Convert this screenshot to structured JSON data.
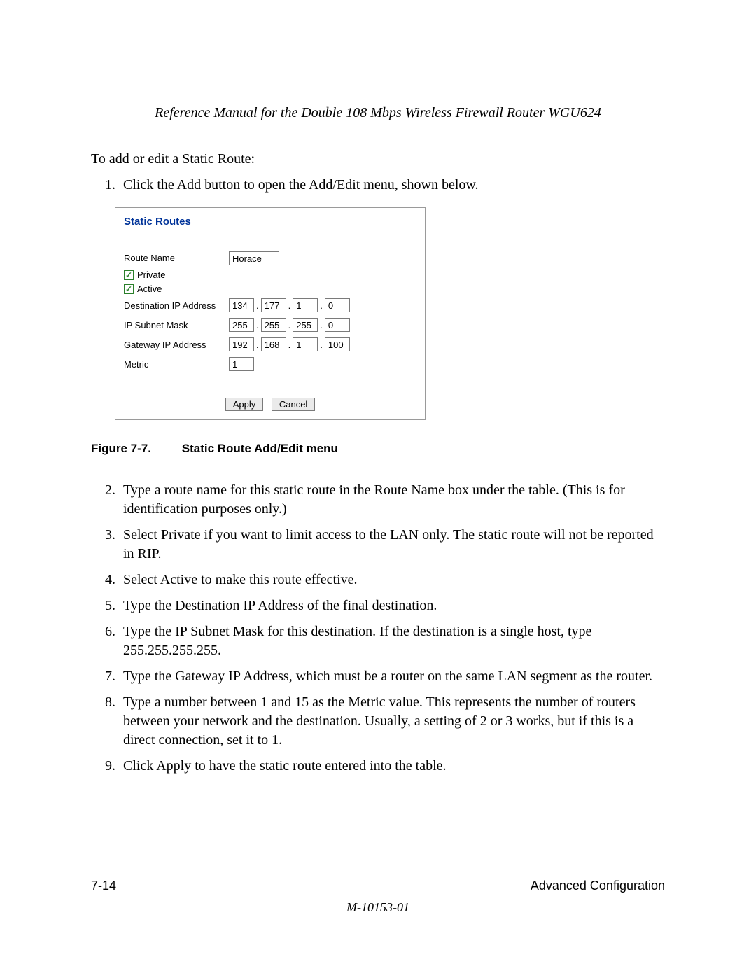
{
  "header": {
    "running_title": "Reference Manual for the Double 108 Mbps Wireless Firewall Router WGU624"
  },
  "intro": "To add or edit a Static Route:",
  "steps": [
    "Click the Add button to open the Add/Edit menu, shown below.",
    "Type a route name for this static route in the Route Name box under the table. (This is for identification purposes only.)",
    "Select Private if you want to limit access to the LAN only. The static route will not be reported in RIP.",
    "Select Active to make this route effective.",
    "Type the Destination IP Address of the final destination.",
    "Type the IP Subnet Mask for this destination. If the destination is a single host, type 255.255.255.255.",
    "Type the Gateway IP Address, which must be a router on the same LAN segment as the router.",
    "Type a number between 1 and 15 as the Metric value. This represents the number of routers between your network and the destination. Usually, a setting of 2 or 3 works, but if this is a direct connection, set it to 1.",
    "Click Apply to have the static route entered into the table."
  ],
  "dialog": {
    "title": "Static Routes",
    "labels": {
      "route_name": "Route Name",
      "private": "Private",
      "active": "Active",
      "dest_ip": "Destination IP Address",
      "subnet": "IP Subnet Mask",
      "gateway": "Gateway IP Address",
      "metric": "Metric"
    },
    "values": {
      "route_name": "Horace",
      "private_checked": true,
      "active_checked": true,
      "dest_ip": [
        "134",
        "177",
        "1",
        "0"
      ],
      "subnet": [
        "255",
        "255",
        "255",
        "0"
      ],
      "gateway": [
        "192",
        "168",
        "1",
        "100"
      ],
      "metric": "1"
    },
    "buttons": {
      "apply": "Apply",
      "cancel": "Cancel"
    }
  },
  "figure": {
    "number": "Figure 7-7.",
    "caption": "Static Route Add/Edit menu"
  },
  "footer": {
    "page": "7-14",
    "section": "Advanced Configuration",
    "doc_number": "M-10153-01"
  }
}
